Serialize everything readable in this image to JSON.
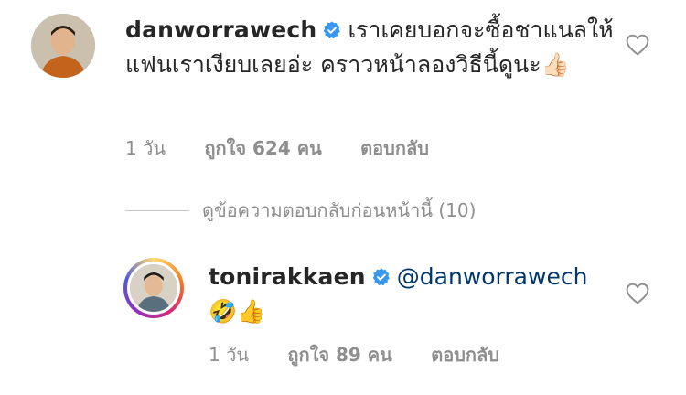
{
  "comment_1": {
    "username": "danworrawech",
    "text": "เราเคยบอกจะซื้อชาแนลให้ แฟนเราเงียบเลยอ่ะ คราวหน้าลองวิธีนี้ดูนะ👍🏻",
    "time": "1 วัน",
    "likes": "ถูกใจ 624 คน",
    "reply": "ตอบกลับ"
  },
  "view_replies": "ดูข้อความตอบกลับก่อนหน้านี้ (10)",
  "comment_2": {
    "username": "tonirakkaen",
    "mention": "@danworrawech",
    "emojis": "🤣👍",
    "time": "1 วัน",
    "likes": "ถูกใจ 89 คน",
    "reply": "ตอบกลับ"
  },
  "colors": {
    "verified": "#3897f0",
    "mention": "#00376b",
    "meta": "#8e8e8e"
  },
  "icons": [
    "verified-badge-icon",
    "heart-outline-icon"
  ]
}
